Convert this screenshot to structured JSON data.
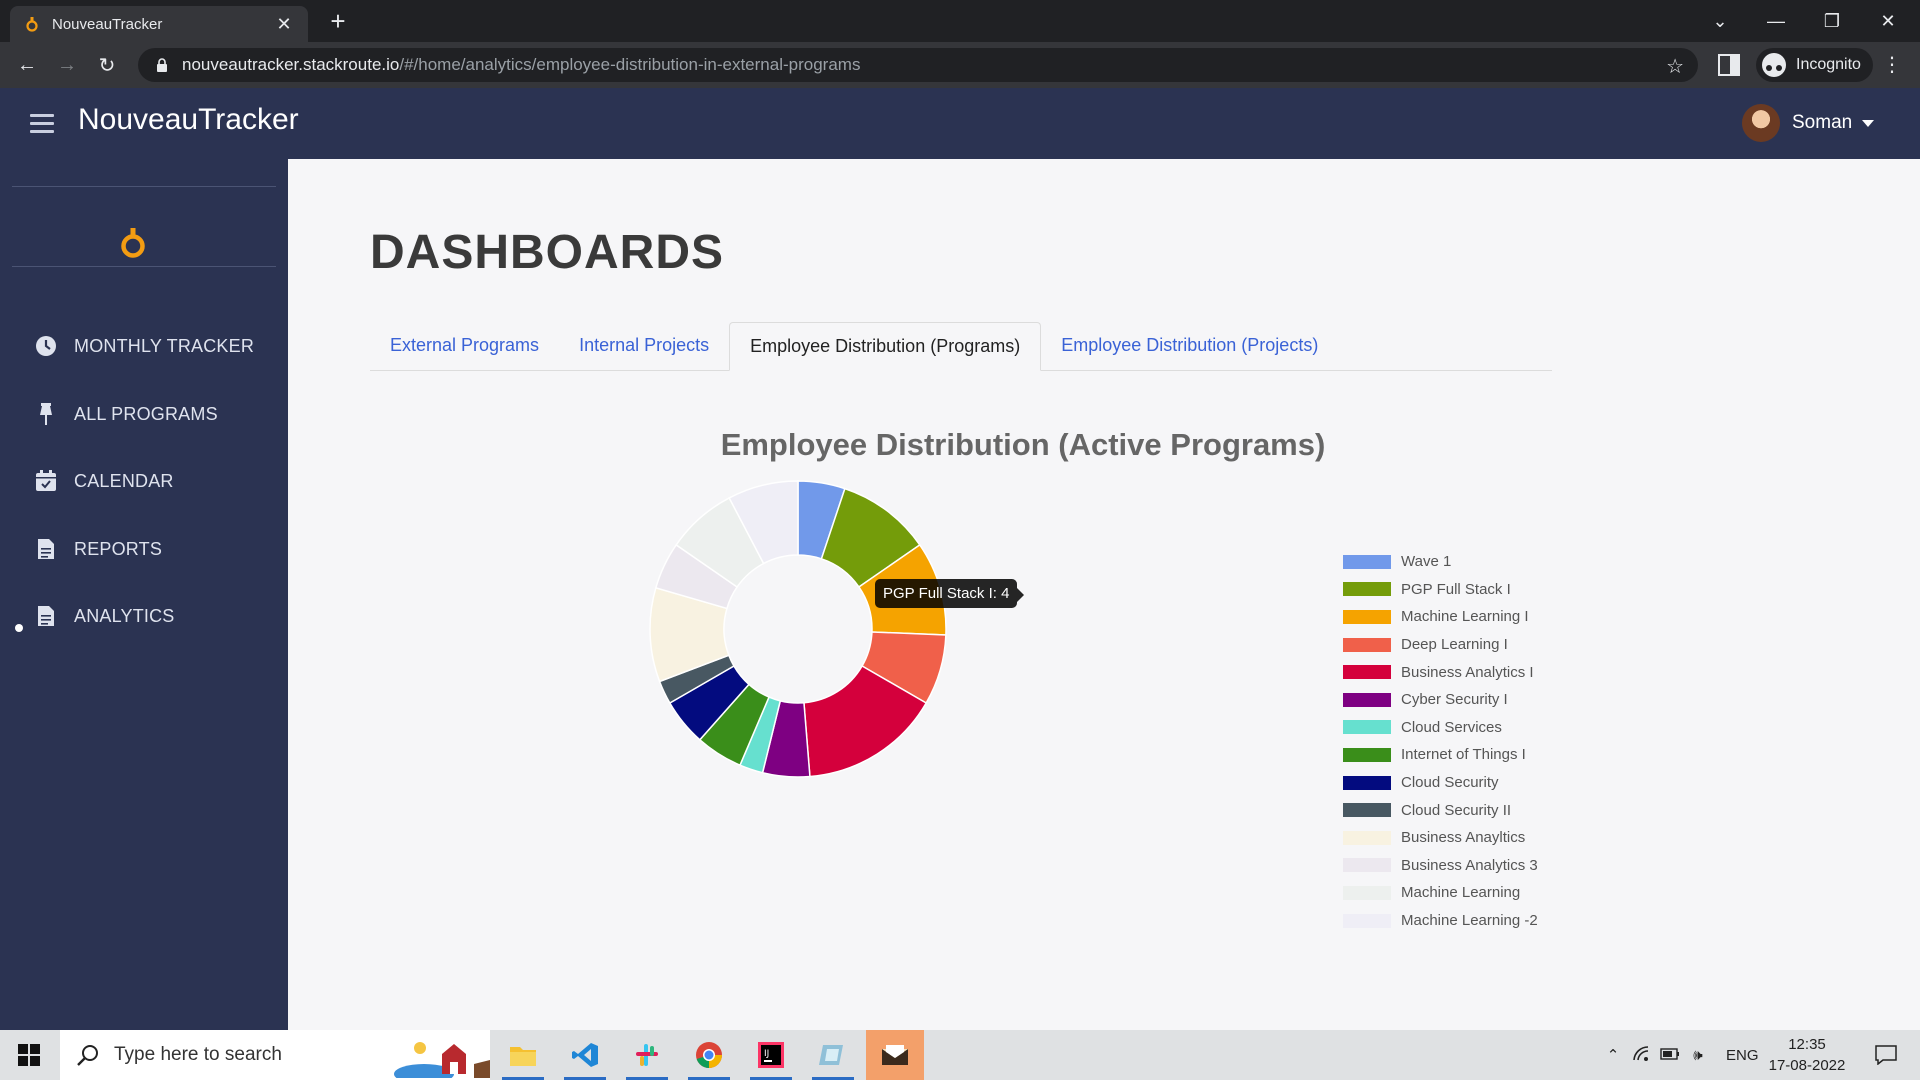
{
  "browser": {
    "tab_title": "NouveauTracker",
    "url_host": "nouveautracker.stackroute.io",
    "url_path": "/#/home/analytics/employee-distribution-in-external-programs",
    "incognito_label": "Incognito"
  },
  "app": {
    "title": "NouveauTracker",
    "user_name": "Soman"
  },
  "sidebar": {
    "items": [
      {
        "label": "MONTHLY TRACKER",
        "icon": "clock-icon"
      },
      {
        "label": "ALL PROGRAMS",
        "icon": "pin-icon"
      },
      {
        "label": "CALENDAR",
        "icon": "calendar-icon"
      },
      {
        "label": "REPORTS",
        "icon": "document-icon"
      },
      {
        "label": "ANALYTICS",
        "icon": "document-icon",
        "active": true
      }
    ]
  },
  "page": {
    "title": "DASHBOARDS",
    "tabs": [
      {
        "label": "External Programs"
      },
      {
        "label": "Internal Projects"
      },
      {
        "label": "Employee Distribution (Programs)",
        "active": true
      },
      {
        "label": "Employee Distribution (Projects)"
      }
    ]
  },
  "tooltip": {
    "text": "PGP Full Stack I: 4"
  },
  "chart_data": {
    "type": "doughnut",
    "title": "Employee Distribution (Active Programs)",
    "legend_position": "right",
    "categories": [
      "Wave 1",
      "PGP Full Stack I",
      "Machine Learning I",
      "Deep Learning I",
      "Business Analytics I",
      "Cyber Security I",
      "Cloud Services",
      "Internet of Things I",
      "Cloud Security",
      "Cloud Security II",
      "Business Anayltics",
      "Business Analytics 3",
      "Machine Learning",
      "Machine Learning -2"
    ],
    "values": [
      2,
      4,
      4,
      3,
      6,
      2,
      1,
      2,
      2,
      1,
      4,
      2,
      3,
      3
    ],
    "colors": [
      "#7199ea",
      "#749c0a",
      "#f5a300",
      "#f0604a",
      "#d4003c",
      "#7e0082",
      "#66e0cf",
      "#3a8e1a",
      "#030b7f",
      "#485862",
      "#f8f2e1",
      "#ece8ef",
      "#edf0ee",
      "#efeef6"
    ]
  },
  "taskbar": {
    "search_placeholder": "Type here to search",
    "language": "ENG",
    "time": "12:35",
    "date": "17-08-2022"
  }
}
